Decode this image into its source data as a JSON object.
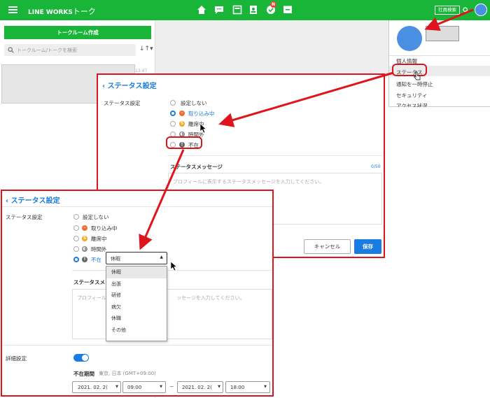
{
  "header": {
    "app_name": "LINE WORKS",
    "app_suffix": "トーク",
    "badge": "N",
    "employee_search": "社員検索"
  },
  "left": {
    "create_button": "トークルーム作成",
    "search_placeholder": "トークルーム/トークを検索",
    "time": "13:47"
  },
  "profile_menu": [
    "個人情報",
    "ステータス",
    "通知を一時停止",
    "セキュリティ",
    "アクセス状況"
  ],
  "panel1": {
    "title": "ステータス設定",
    "section_label": "ステータス設定",
    "options": [
      "設定しない",
      "取り込み中",
      "離席中",
      "時間外",
      "不在"
    ],
    "message_label": "ステータスメッセージ",
    "count": "0/50",
    "placeholder": "プロフィールに表示するステータスメッセージを入力してください。",
    "cancel": "キャンセル",
    "save": "保存"
  },
  "panel2": {
    "title": "ステータス設定",
    "section_label": "ステータス設定",
    "options": [
      "設定しない",
      "取り込み中",
      "離席中",
      "時間外",
      "不在"
    ],
    "select_value": "休暇",
    "dropdown": [
      "休暇",
      "出張",
      "研修",
      "病欠",
      "休職",
      "その他"
    ],
    "message_label_partial": "ステータスメ",
    "placeholder_left": "プロフィール",
    "placeholder_right": "ッセージを入力してください。",
    "detail_label": "詳細設定",
    "absence_label": "不在期間",
    "timezone": "東京, 日本 (GMT+09:00)",
    "start_date": "2021. 02. 2(",
    "start_time": "09:00",
    "tilde": "~",
    "end_date": "2021. 02. 2(",
    "end_time": "18:00"
  },
  "colors": {
    "green": "#19b539",
    "blue": "#1a7ce0",
    "red": "#d9161e"
  }
}
